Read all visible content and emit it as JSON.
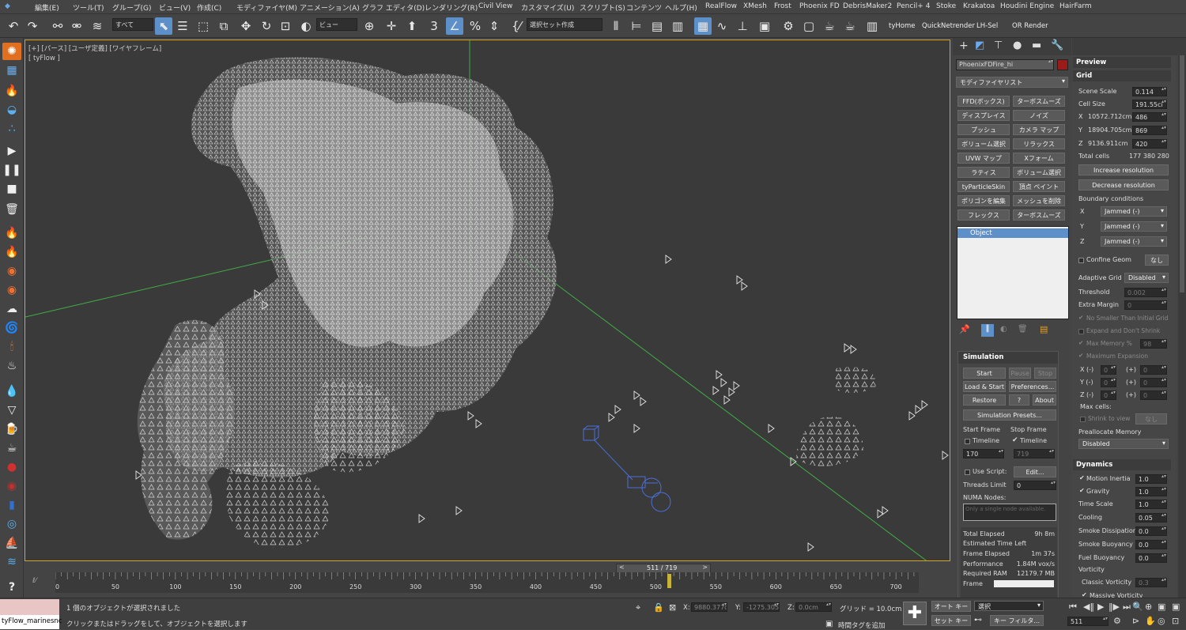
{
  "menu": [
    "編集(E)",
    "ツール(T)",
    "グループ(G)",
    "ビュー(V)",
    "作成(C)",
    "モディファイヤ(M)",
    "アニメーション(A)",
    "グラフ エディタ(D)",
    "レンダリング(R)",
    "Civil View",
    "カスタマイズ(U)",
    "スクリプト(S)",
    "コンテンツ",
    "ヘルプ(H)",
    "RealFlow",
    "XMesh",
    "Frost",
    "Phoenix FD",
    "DebrisMaker2",
    "Pencil+ 4",
    "Stoke",
    "Krakatoa",
    "Houdini Engine",
    "HairFarm"
  ],
  "toolbar": {
    "filter_dropdown": "すべて",
    "view_dropdown": "ビュー",
    "selection_set": "選択セット作成",
    "shelf_buttons": [
      "tyHome",
      "QuickNetrender",
      "LH-Sel",
      "OR Render"
    ]
  },
  "viewport": {
    "label1": "[+] [パース] [ユーザ定義] [ワイヤフレーム]",
    "label2": "[ tyFlow ]"
  },
  "command_panel": {
    "object_name": "PhoenixFDFire_hi",
    "object_color": "#9b1b1b",
    "modifier_list": "モディファイヤリスト",
    "modifier_buttons": [
      "FFD(ボックス)",
      "ターボスムーズ",
      "ディスプレイス",
      "ノイズ",
      "プッシュ",
      "カメラ マップ",
      "ボリューム選択",
      "リラックス",
      "UVW マップ",
      "Xフォーム",
      "ラティス",
      "ボリューム選択",
      "tyParticleSkin",
      "頂点 ペイント",
      "ポリゴンを編集",
      "メッシュを削除",
      "フレックス",
      "ターボスムーズ"
    ],
    "stack_item": "Object"
  },
  "simulation": {
    "title": "Simulation",
    "start": "Start",
    "pause": "Pause",
    "stop": "Stop",
    "load_start": "Load & Start",
    "preferences": "Preferences...",
    "restore": "Restore",
    "help": "?",
    "about": "About",
    "presets": "Simulation Presets...",
    "start_frame_label": "Start Frame",
    "stop_frame_label": "Stop Frame",
    "timeline_label": "Timeline",
    "timeline_label2": "Timeline",
    "start_frame": "170",
    "stop_frame": "719",
    "use_script": "Use Script:",
    "edit": "Edit...",
    "threads_limit": "Threads Limit",
    "threads_value": "0",
    "numa_nodes": "NUMA Nodes:",
    "numa_placeholder": "Only a single node available.",
    "stats": [
      {
        "label": "Total Elapsed",
        "value": "9h 8m"
      },
      {
        "label": "Estimated Time Left",
        "value": ""
      },
      {
        "label": "Frame Elapsed",
        "value": "1m 37s"
      },
      {
        "label": "Performance",
        "value": "1.84M vox/s"
      },
      {
        "label": "Required RAM",
        "value": "12179.7 MB"
      },
      {
        "label": "Frame",
        "value": ""
      }
    ]
  },
  "rollout": {
    "preview": "Preview",
    "grid": "Grid",
    "scene_scale_label": "Scene Scale",
    "scene_scale": "0.114",
    "cell_size_label": "Cell Size",
    "cell_size": "191.55cı",
    "x_label": "X",
    "x_size": "10572.712cm",
    "x_cells": "486",
    "y_label": "Y",
    "y_size": "18904.705cm",
    "y_cells": "869",
    "z_label": "Z",
    "z_size": "9136.911cm",
    "z_cells": "420",
    "total_cells_label": "Total cells",
    "total_cells": "177 380 280",
    "increase": "Increase resolution",
    "decrease": "Decrease resolution",
    "boundary": "Boundary conditions",
    "bx": "X",
    "by": "Y",
    "bz": "Z",
    "bxv": "Jammed (-)",
    "byv": "Jammed (-)",
    "bzv": "Jammed (-)",
    "confine": "Confine Geom",
    "none": "なし",
    "adaptive_label": "Adaptive Grid",
    "adaptive": "Disabled",
    "threshold_label": "Threshold",
    "threshold": "0.002",
    "extra_margin_label": "Extra Margin",
    "extra_margin": "0",
    "no_smaller": "No Smaller Than Initial Grid",
    "expand": "Expand and Don't Shrink",
    "max_mem_label": "Max Memory %",
    "max_mem": "98",
    "max_expansion": "Maximum Expansion",
    "xm": "X (-)",
    "ym": "Y (-)",
    "zm": "Z (-)",
    "plus": "(+)",
    "zero": "0",
    "max_cells": "Max cells:",
    "shrink": "Shrink to view",
    "none2": "なし",
    "prealloc_label": "Preallocate Memory",
    "prealloc": "Disabled",
    "dynamics": "Dynamics",
    "motion_inertia_label": "Motion Inertia",
    "motion_inertia": "1.0",
    "gravity_label": "Gravity",
    "gravity": "1.0",
    "time_scale_label": "Time Scale",
    "time_scale": "1.0",
    "cooling_label": "Cooling",
    "cooling": "0.05",
    "smoke_diss_label": "Smoke Dissipation",
    "smoke_diss": "0.0",
    "smoke_buoy_label": "Smoke Buoyancy",
    "smoke_buoy": "0.0",
    "fuel_buoy_label": "Fuel Buoyancy",
    "fuel_buoy": "0.0",
    "vorticity": "Vorticity",
    "classic_label": "Classic Vorticity",
    "classic": "0.3",
    "massive_label": "Massive Vorticity"
  },
  "timeline": {
    "frame_counter": "511 / 719",
    "ticks": [
      "0",
      "50",
      "100",
      "150",
      "200",
      "250",
      "300",
      "350",
      "400",
      "450",
      "500",
      "550",
      "600",
      "650",
      "700"
    ]
  },
  "status": {
    "listener": "tyFlow_marinesnc",
    "selected": "1 個のオブジェクトが選択されました",
    "hint": "クリックまたはドラッグをして、オブジェクトを選択します",
    "x_label": "X:",
    "x": "9880.377c",
    "y_label": "Y:",
    "y": "-1275.305",
    "z_label": "Z:",
    "z": "0.0cm",
    "grid": "グリッド = 10.0cm",
    "add_time_tag": "時間タグを追加",
    "auto_key": "オート キー",
    "set_key": "セット キー",
    "key_mode": "選択",
    "key_filter": "キー フィルタ...",
    "frame": "511"
  },
  "colors": {
    "accent": "#5d8fc9",
    "viewport_border": "#d7a31e",
    "axis_green": "#3fae46"
  }
}
